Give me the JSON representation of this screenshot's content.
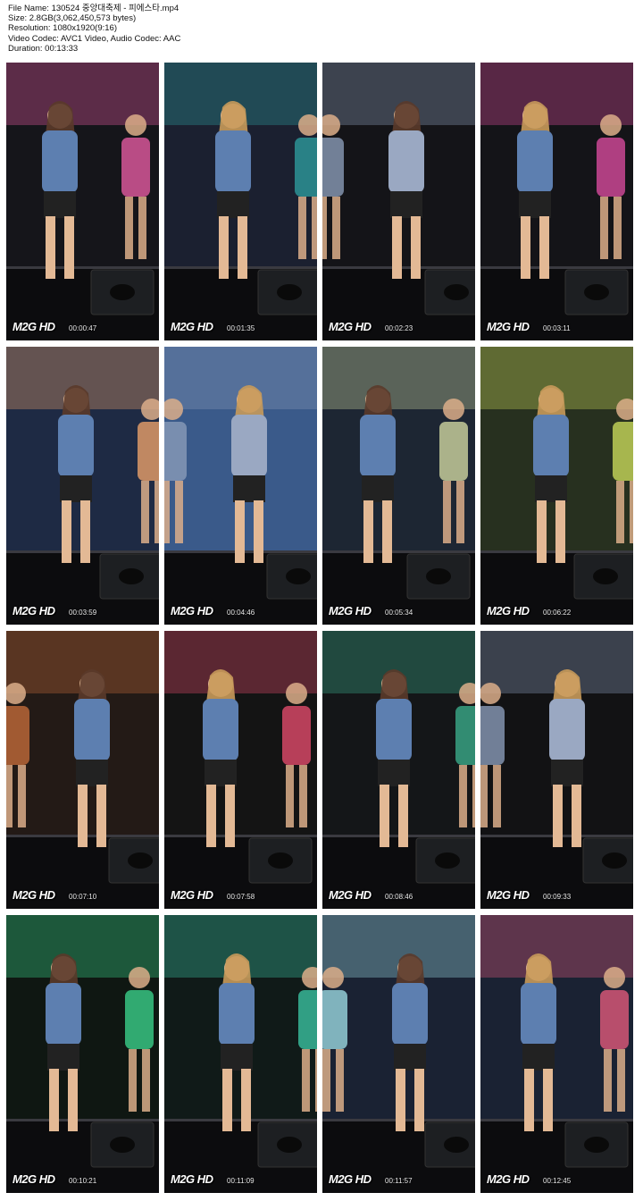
{
  "meta": {
    "file_name": "File Name: 130524 중앙대축제 - 피에스타.mp4",
    "size": "Size: 2.8GB(3,062,450,573 bytes)",
    "resolution": "Resolution: 1080x1920(9:16)",
    "video_codec": "Video Codec: AVC1 Video, Audio Codec: AAC",
    "duration": "Duration: 00:13:33"
  },
  "watermark": "M2G HD",
  "thumbnails": [
    {
      "time": "00:00:47",
      "scene": "stage-denim-jacket-pink-outfit",
      "bg": "#15151a",
      "accent": "#e25aa0"
    },
    {
      "time": "00:01:35",
      "scene": "stage-denim-jacket-dancing",
      "bg": "#1b2030",
      "accent": "#2d9a9c"
    },
    {
      "time": "00:02:23",
      "scene": "stage-denim-dress-arms-out",
      "bg": "#141418",
      "accent": "#8a9bb8"
    },
    {
      "time": "00:03:11",
      "scene": "stage-singer-with-microphone",
      "bg": "#141418",
      "accent": "#d64a9c"
    },
    {
      "time": "00:03:59",
      "scene": "stage-group-standing",
      "bg": "#1e2a44",
      "accent": "#e8a06a"
    },
    {
      "time": "00:04:46",
      "scene": "stage-dress-hand-on-head",
      "bg": "#3a5a8a",
      "accent": "#8a9bb8"
    },
    {
      "time": "00:05:34",
      "scene": "stage-blonde-denim-jacket",
      "bg": "#1d2633",
      "accent": "#cfd6a0"
    },
    {
      "time": "00:06:22",
      "scene": "stage-dancers-pose",
      "bg": "#27301f",
      "accent": "#c8d85a"
    },
    {
      "time": "00:07:10",
      "scene": "stage-singer-red-screen",
      "bg": "#231a16",
      "accent": "#c06a3a"
    },
    {
      "time": "00:07:58",
      "scene": "stage-dancer-profile",
      "bg": "#141414",
      "accent": "#e04a6a"
    },
    {
      "time": "00:08:46",
      "scene": "stage-group-walking",
      "bg": "#141618",
      "accent": "#3aaa8a"
    },
    {
      "time": "00:09:33",
      "scene": "stage-two-members-smiling",
      "bg": "#121214",
      "accent": "#8a9bb8"
    },
    {
      "time": "00:10:21",
      "scene": "stage-dancer-green-lights",
      "bg": "#0f1712",
      "accent": "#3ad08a"
    },
    {
      "time": "00:11:09",
      "scene": "stage-singing-duo",
      "bg": "#101a18",
      "accent": "#3ac0a0"
    },
    {
      "time": "00:11:57",
      "scene": "stage-singer-denim-jacket",
      "bg": "#1a2233",
      "accent": "#9ad8e0"
    },
    {
      "time": "00:12:45",
      "scene": "stage-finale-pose",
      "bg": "#1a2233",
      "accent": "#e05a7a"
    }
  ]
}
